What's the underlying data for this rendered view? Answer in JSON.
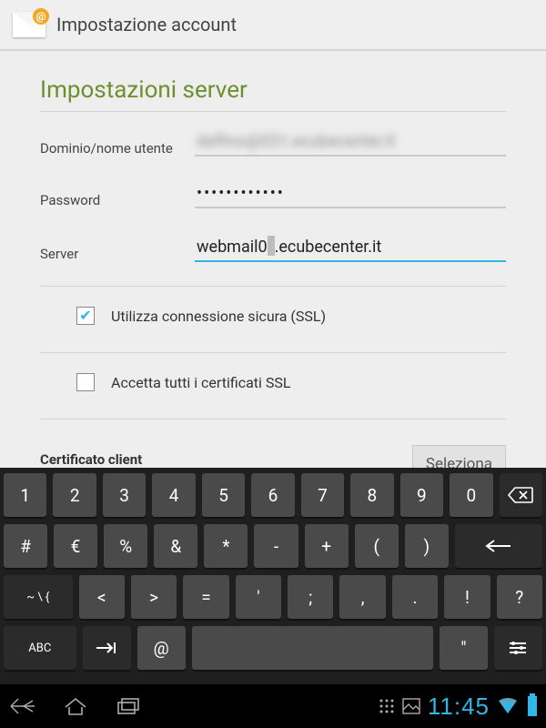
{
  "appbar": {
    "title": "Impostazione account"
  },
  "heading": "Impostazioni server",
  "fields": {
    "domain_label": "Dominio/nome utente",
    "domain_value": "delfino@051.ecubecenter.it",
    "password_label": "Password",
    "password_value": "••••••••••••",
    "server_label": "Server",
    "server_value_pre": "webmail0",
    "server_value_post": ".ecubecenter.it"
  },
  "checks": {
    "ssl_label": "Utilizza connessione sicura (SSL)",
    "ssl_checked": true,
    "accept_all_label": "Accetta tutti i certificati SSL",
    "accept_all_checked": false
  },
  "cert": {
    "label": "Certificato client",
    "button": "Seleziona"
  },
  "keyboard": {
    "row1": [
      "1",
      "2",
      "3",
      "4",
      "5",
      "6",
      "7",
      "8",
      "9",
      "0",
      "⌫"
    ],
    "row2": [
      "#",
      "€",
      "%",
      "&",
      "*",
      "-",
      "+",
      "(",
      ")",
      "⏎"
    ],
    "row3": [
      "~ \\ {",
      "<",
      ">",
      "=",
      "'",
      ";",
      ",",
      ".",
      "!",
      "?"
    ],
    "row4": [
      "ABC",
      "⇥|",
      "@",
      "space",
      "\"",
      "⚙"
    ]
  },
  "statusbar": {
    "clock": "11:45"
  }
}
